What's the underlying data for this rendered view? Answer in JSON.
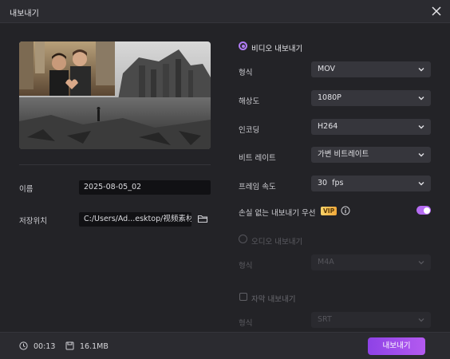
{
  "window": {
    "title": "내보내기"
  },
  "left": {
    "name_label": "이름",
    "name_value": "2025-08-05_02",
    "location_label": "저장위치",
    "location_value": "C:/Users/Ad...esktop/视频素材"
  },
  "video_export": {
    "title": "비디오 내보내기",
    "rows": [
      {
        "label": "형식",
        "value": "MOV"
      },
      {
        "label": "해상도",
        "value": "1080P"
      },
      {
        "label": "인코딩",
        "value": "H264"
      },
      {
        "label": "비트 레이트",
        "value": "가변 비트레이트"
      },
      {
        "label": "프레임 속도",
        "value": "30  fps"
      }
    ],
    "lossless_label": "손실 없는 내보내기 우선",
    "vip_badge": "VIP"
  },
  "audio_export": {
    "title": "오디오 내보내기",
    "format_label": "형식",
    "format_value": "M4A"
  },
  "subtitle_export": {
    "title": "자막 내보내기",
    "format_label": "형식",
    "format_value": "SRT"
  },
  "footer": {
    "duration": "00:13",
    "size": "16.1MB",
    "export_button": "내보내기"
  },
  "colors": {
    "accent": "#b07cf5",
    "export_button": "#9b4fe9",
    "vip": "#f4c04f",
    "background": "#232327"
  },
  "toggles": {
    "lossless_first": true
  }
}
